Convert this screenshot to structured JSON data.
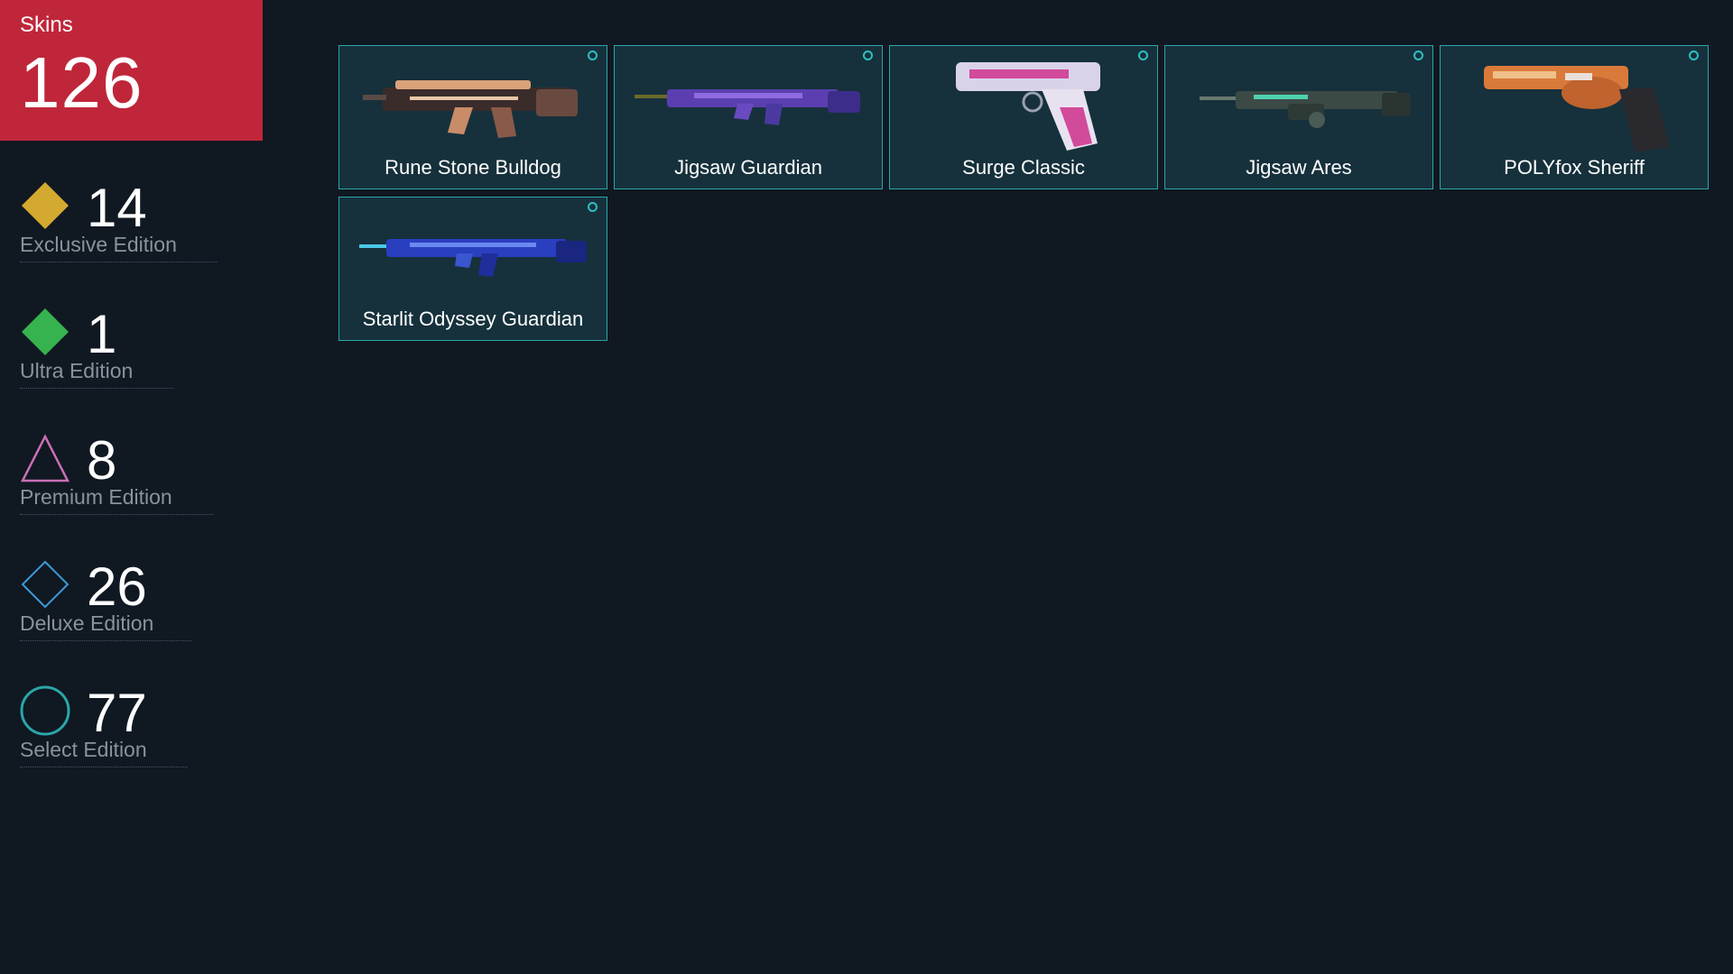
{
  "header": {
    "title": "Skins",
    "total": "126",
    "color": "#c0263a"
  },
  "editions": [
    {
      "count": "14",
      "label": "Exclusive Edition",
      "icon": "gold-diamond-icon",
      "color": "#d4a92f"
    },
    {
      "count": "1",
      "label": "Ultra Edition",
      "icon": "green-diamond-icon",
      "color": "#36b24e"
    },
    {
      "count": "8",
      "label": "Premium Edition",
      "icon": "pink-triangle-icon",
      "color": "#c96fb3"
    },
    {
      "count": "26",
      "label": "Deluxe Edition",
      "icon": "blue-diamond-outline-icon",
      "color": "#3a9ad9"
    },
    {
      "count": "77",
      "label": "Select Edition",
      "icon": "teal-circle-outline-icon",
      "color": "#2aa6a8"
    }
  ],
  "skins": [
    {
      "name": "Rune Stone Bulldog",
      "icon": "rifle-bulldog-icon",
      "edition_marker": "select-circle-icon"
    },
    {
      "name": "Jigsaw Guardian",
      "icon": "rifle-guardian-icon",
      "edition_marker": "select-circle-icon"
    },
    {
      "name": "Surge Classic",
      "icon": "pistol-classic-icon",
      "edition_marker": "select-circle-icon"
    },
    {
      "name": "Jigsaw Ares",
      "icon": "machinegun-ares-icon",
      "edition_marker": "select-circle-icon"
    },
    {
      "name": "POLYfox Sheriff",
      "icon": "revolver-sheriff-icon",
      "edition_marker": "select-circle-icon"
    },
    {
      "name": "Starlit Odyssey Guardian",
      "icon": "rifle-guardian-icon",
      "edition_marker": "select-circle-icon"
    }
  ]
}
